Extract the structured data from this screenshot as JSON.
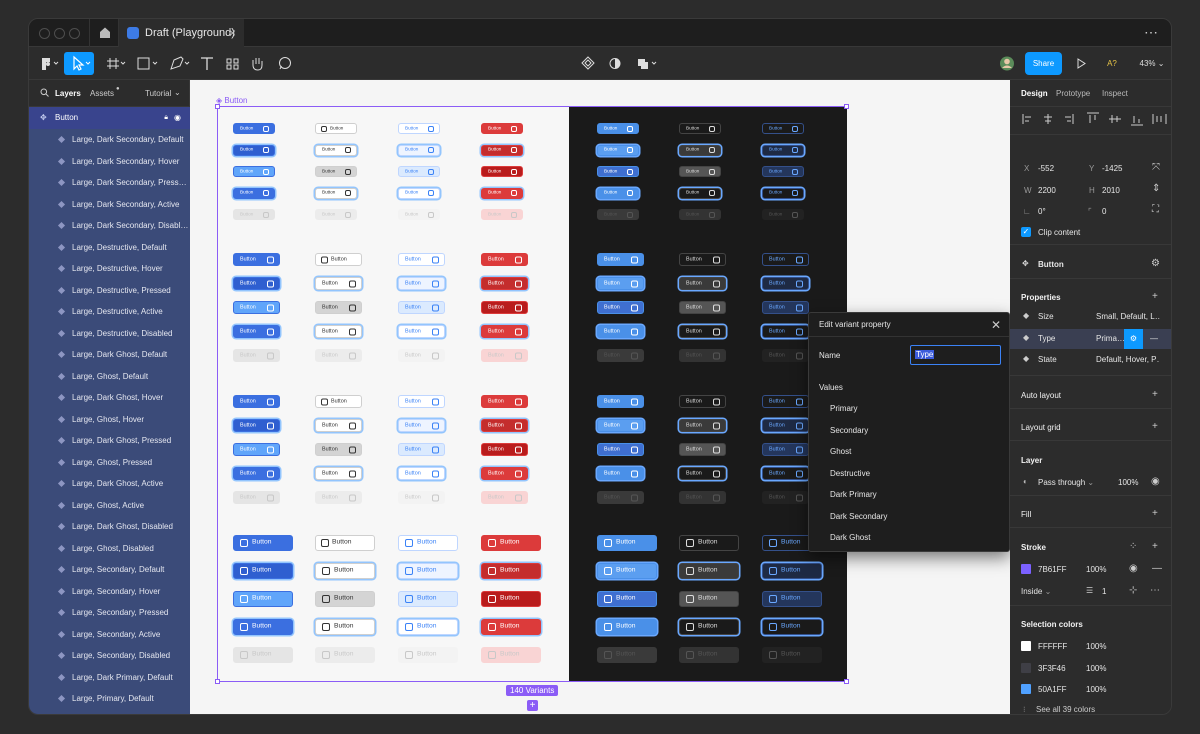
{
  "window": {
    "tab_title": "Draft (Playground)",
    "close": "×",
    "more": "⋯"
  },
  "toolbar": {
    "share": "Share",
    "zoom": "43%",
    "a_label": "A?"
  },
  "left_panel": {
    "tabs": {
      "layers": "Layers",
      "assets": "Assets",
      "page": "Tutorial"
    },
    "selected_layer": "Button",
    "layers": [
      "Large, Dark Secondary, Default",
      "Large, Dark Secondary, Hover",
      "Large, Dark Secondary, Press…",
      "Large, Dark Secondary, Active",
      "Large, Dark Secondary, Disabl…",
      "Large, Destructive, Default",
      "Large, Destructive, Hover",
      "Large, Destructive, Pressed",
      "Large, Destructive, Active",
      "Large, Destructive, Disabled",
      "Large, Dark Ghost, Default",
      "Large, Ghost, Default",
      "Large, Dark Ghost, Hover",
      "Large, Ghost, Hover",
      "Large, Dark Ghost, Pressed",
      "Large, Ghost, Pressed",
      "Large, Dark Ghost, Active",
      "Large, Ghost, Active",
      "Large, Dark Ghost, Disabled",
      "Large, Ghost, Disabled",
      "Large, Secondary, Default",
      "Large, Secondary, Hover",
      "Large, Secondary, Pressed",
      "Large, Secondary, Active",
      "Large, Secondary, Disabled",
      "Large, Dark Primary, Default",
      "Large, Primary, Default"
    ]
  },
  "canvas": {
    "frame_label": "Button",
    "variants_badge": "140 Variants",
    "button_text": "Button"
  },
  "popup": {
    "title": "Edit variant property",
    "name_label": "Name",
    "name_value": "Type",
    "values_label": "Values",
    "values": [
      "Primary",
      "Secondary",
      "Ghost",
      "Destructive",
      "Dark Primary",
      "Dark Secondary",
      "Dark Ghost"
    ]
  },
  "right_panel": {
    "tabs": {
      "design": "Design",
      "prototype": "Prototype",
      "inspect": "Inspect"
    },
    "x_label": "X",
    "x": "-552",
    "y_label": "Y",
    "y": "-1425",
    "w_label": "W",
    "w": "2200",
    "h_label": "H",
    "h": "2010",
    "rotation": "0°",
    "radius": "0",
    "clip_content": "Clip content",
    "component": "Button",
    "properties_title": "Properties",
    "properties": [
      {
        "name": "Size",
        "value": "Small, Default, L…"
      },
      {
        "name": "Type",
        "value": "Prima…"
      },
      {
        "name": "State",
        "value": "Default, Hover, P…"
      }
    ],
    "auto_layout": "Auto layout",
    "layout_grid": "Layout grid",
    "layer_title": "Layer",
    "blend": "Pass through",
    "opacity": "100%",
    "fill": "Fill",
    "stroke_title": "Stroke",
    "stroke_color": "7B61FF",
    "stroke_opacity": "100%",
    "stroke_position": "Inside",
    "stroke_weight": "1",
    "selection_colors_title": "Selection colors",
    "selection_colors": [
      {
        "hex": "FFFFFF",
        "opacity": "100%",
        "swatch": "#FFFFFF"
      },
      {
        "hex": "3F3F46",
        "opacity": "100%",
        "swatch": "#3F3F46"
      },
      {
        "hex": "50A1FF",
        "opacity": "100%",
        "swatch": "#50A1FF"
      }
    ],
    "see_all": "See all 39 colors"
  },
  "colors": {
    "accent": "#0D99FF",
    "selection": "#8B5CF6",
    "layer_bg": "#3B4B79",
    "stroke_swatch": "#7B61FF"
  }
}
